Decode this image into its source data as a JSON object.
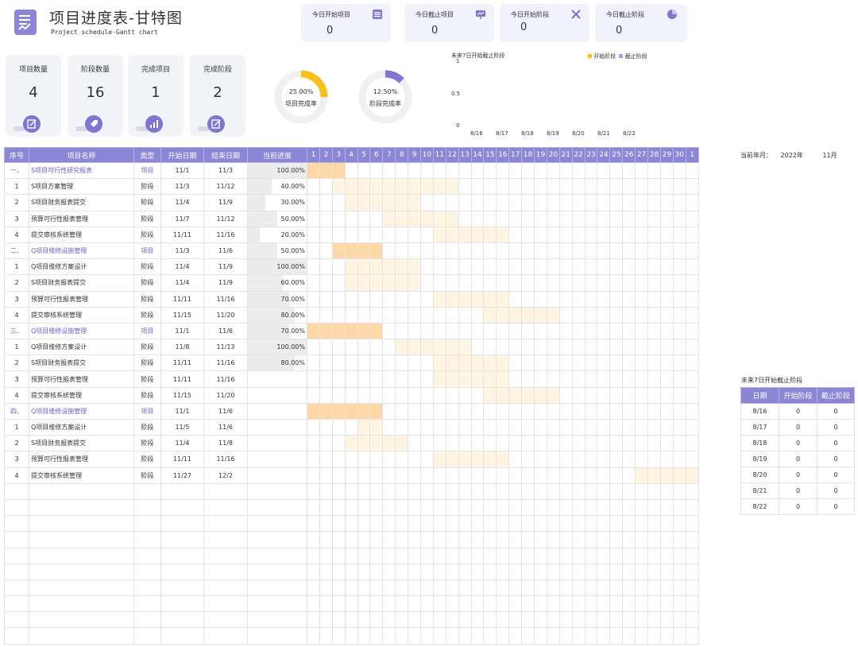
{
  "header": {
    "title": "项目进度表-甘特图",
    "subtitle": "Project schedule-Gantt chart"
  },
  "today_cards": [
    {
      "label": "今日开始项目",
      "value": "0",
      "icon": "list-icon"
    },
    {
      "label": "今日截止项目",
      "value": "0",
      "icon": "presentation-icon"
    },
    {
      "label": "今日开始阶段",
      "value": "0",
      "icon": "tools-icon"
    },
    {
      "label": "今日截止阶段",
      "value": "0",
      "icon": "pie-icon"
    }
  ],
  "stats": [
    {
      "label": "项目数量",
      "value": "4",
      "icon": "edit-icon"
    },
    {
      "label": "阶段数量",
      "value": "16",
      "icon": "tag-icon"
    },
    {
      "label": "完成项目",
      "value": "1",
      "icon": "bar-chart-icon"
    },
    {
      "label": "完成阶段",
      "value": "2",
      "icon": "edit-icon"
    }
  ],
  "rates": [
    {
      "pct": "25.00%",
      "label": "项目完成率",
      "fraction": 0.25,
      "color": "#f9c01b"
    },
    {
      "pct": "12.50%",
      "label": "阶段完成率",
      "fraction": 0.125,
      "color": "#7e76d1"
    }
  ],
  "mini_chart": {
    "title": "未来7日开始截止阶段",
    "legend_start": "开始阶段",
    "legend_end": "截止阶段",
    "ticks": [
      "1",
      "0.5",
      "0"
    ],
    "categories": [
      "8/16",
      "8/17",
      "8/18",
      "8/19",
      "8/20",
      "8/21",
      "8/22"
    ],
    "color_start": "#f9c01b",
    "color_end": "#9aa3e0"
  },
  "chart_data": {
    "type": "bar",
    "title": "未来7日开始截止阶段",
    "categories": [
      "8/16",
      "8/17",
      "8/18",
      "8/19",
      "8/20",
      "8/21",
      "8/22"
    ],
    "series": [
      {
        "name": "开始阶段",
        "values": [
          0,
          0,
          0,
          0,
          0,
          0,
          0
        ]
      },
      {
        "name": "截止阶段",
        "values": [
          0,
          0,
          0,
          0,
          0,
          0,
          0
        ]
      }
    ],
    "ylim": [
      0,
      1
    ]
  },
  "table": {
    "headers": [
      "序号",
      "项目名称",
      "类型",
      "开始日期",
      "结束日期",
      "当前进度"
    ],
    "days": [
      "1",
      "2",
      "3",
      "4",
      "5",
      "6",
      "7",
      "8",
      "9",
      "10",
      "11",
      "12",
      "13",
      "14",
      "15",
      "16",
      "17",
      "18",
      "19",
      "20",
      "21",
      "22",
      "23",
      "24",
      "25",
      "26",
      "27",
      "28",
      "29",
      "30",
      "1"
    ],
    "rows": [
      {
        "idx": "一、",
        "name": "S项目可行性研究报表",
        "type": "项目",
        "start": "11/1",
        "end": "11/3",
        "progress": "100.00%",
        "p": 1,
        "s": 1,
        "e": 3,
        "proj": true
      },
      {
        "idx": "1",
        "name": "S项目方案管理",
        "type": "阶段",
        "start": "11/3",
        "end": "11/12",
        "progress": "40.00%",
        "p": 0.4,
        "s": 3,
        "e": 12
      },
      {
        "idx": "2",
        "name": "S项目财务报表提交",
        "type": "阶段",
        "start": "11/4",
        "end": "11/9",
        "progress": "30.00%",
        "p": 0.3,
        "s": 4,
        "e": 9
      },
      {
        "idx": "3",
        "name": "预算可行性报表管理",
        "type": "阶段",
        "start": "11/7",
        "end": "11/12",
        "progress": "50.00%",
        "p": 0.5,
        "s": 7,
        "e": 12
      },
      {
        "idx": "4",
        "name": "提交审核系统管理",
        "type": "阶段",
        "start": "11/11",
        "end": "11/16",
        "progress": "20.00%",
        "p": 0.2,
        "s": 11,
        "e": 16
      },
      {
        "idx": "二、",
        "name": "Q项目维修设施管理",
        "type": "项目",
        "start": "11/3",
        "end": "11/6",
        "progress": "50.00%",
        "p": 0.5,
        "s": 3,
        "e": 6,
        "proj": true
      },
      {
        "idx": "1",
        "name": "Q项目维修方案设计",
        "type": "阶段",
        "start": "11/4",
        "end": "11/9",
        "progress": "100.00%",
        "p": 1,
        "s": 4,
        "e": 9
      },
      {
        "idx": "2",
        "name": "S项目财务报表提交",
        "type": "阶段",
        "start": "11/4",
        "end": "11/9",
        "progress": "60.00%",
        "p": 0.6,
        "s": 4,
        "e": 9
      },
      {
        "idx": "3",
        "name": "预算可行性报表管理",
        "type": "阶段",
        "start": "11/11",
        "end": "11/16",
        "progress": "70.00%",
        "p": 0.7,
        "s": 11,
        "e": 16
      },
      {
        "idx": "4",
        "name": "提交审核系统管理",
        "type": "阶段",
        "start": "11/15",
        "end": "11/20",
        "progress": "80.00%",
        "p": 0.8,
        "s": 15,
        "e": 20
      },
      {
        "idx": "三、",
        "name": "Q项目维修设施管理",
        "type": "项目",
        "start": "11/1",
        "end": "11/6",
        "progress": "70.00%",
        "p": 0.7,
        "s": 1,
        "e": 6,
        "proj": true
      },
      {
        "idx": "1",
        "name": "Q项目维修方案设计",
        "type": "阶段",
        "start": "11/8",
        "end": "11/13",
        "progress": "100.00%",
        "p": 1,
        "s": 8,
        "e": 13
      },
      {
        "idx": "2",
        "name": "S项目财务报表提交",
        "type": "阶段",
        "start": "11/11",
        "end": "11/16",
        "progress": "80.00%",
        "p": 0.8,
        "s": 11,
        "e": 16
      },
      {
        "idx": "3",
        "name": "预算可行性报表管理",
        "type": "阶段",
        "start": "11/11",
        "end": "11/16",
        "progress": "",
        "p": 0,
        "s": 11,
        "e": 16
      },
      {
        "idx": "4",
        "name": "提交审核系统管理",
        "type": "阶段",
        "start": "11/15",
        "end": "11/20",
        "progress": "",
        "p": 0,
        "s": 15,
        "e": 20
      },
      {
        "idx": "四、",
        "name": "Q项目维修设施管理",
        "type": "项目",
        "start": "11/1",
        "end": "11/6",
        "progress": "",
        "p": 0,
        "s": 1,
        "e": 6,
        "proj": true
      },
      {
        "idx": "1",
        "name": "Q项目维修方案设计",
        "type": "阶段",
        "start": "11/5",
        "end": "11/6",
        "progress": "",
        "p": 0,
        "s": 5,
        "e": 6
      },
      {
        "idx": "2",
        "name": "S项目财务报表提交",
        "type": "阶段",
        "start": "11/4",
        "end": "11/8",
        "progress": "",
        "p": 0,
        "s": 4,
        "e": 8
      },
      {
        "idx": "3",
        "name": "预算可行性报表管理",
        "type": "阶段",
        "start": "11/11",
        "end": "11/16",
        "progress": "",
        "p": 0,
        "s": 11,
        "e": 16
      },
      {
        "idx": "4",
        "name": "提交审核系统管理",
        "type": "阶段",
        "start": "11/27",
        "end": "12/2",
        "progress": "",
        "p": 0,
        "s": 27,
        "e": 31
      }
    ]
  },
  "meta": {
    "label": "当前年月：",
    "year": "2022年",
    "month": "11月"
  },
  "side": {
    "title": "未来7日开始截止阶段",
    "headers": [
      "日期",
      "开始阶段",
      "截止阶段"
    ],
    "rows": [
      [
        "8/16",
        "0",
        "0"
      ],
      [
        "8/17",
        "0",
        "0"
      ],
      [
        "8/18",
        "0",
        "0"
      ],
      [
        "8/19",
        "0",
        "0"
      ],
      [
        "8/20",
        "0",
        "0"
      ],
      [
        "8/21",
        "0",
        "0"
      ],
      [
        "8/22",
        "0",
        "0"
      ]
    ]
  }
}
